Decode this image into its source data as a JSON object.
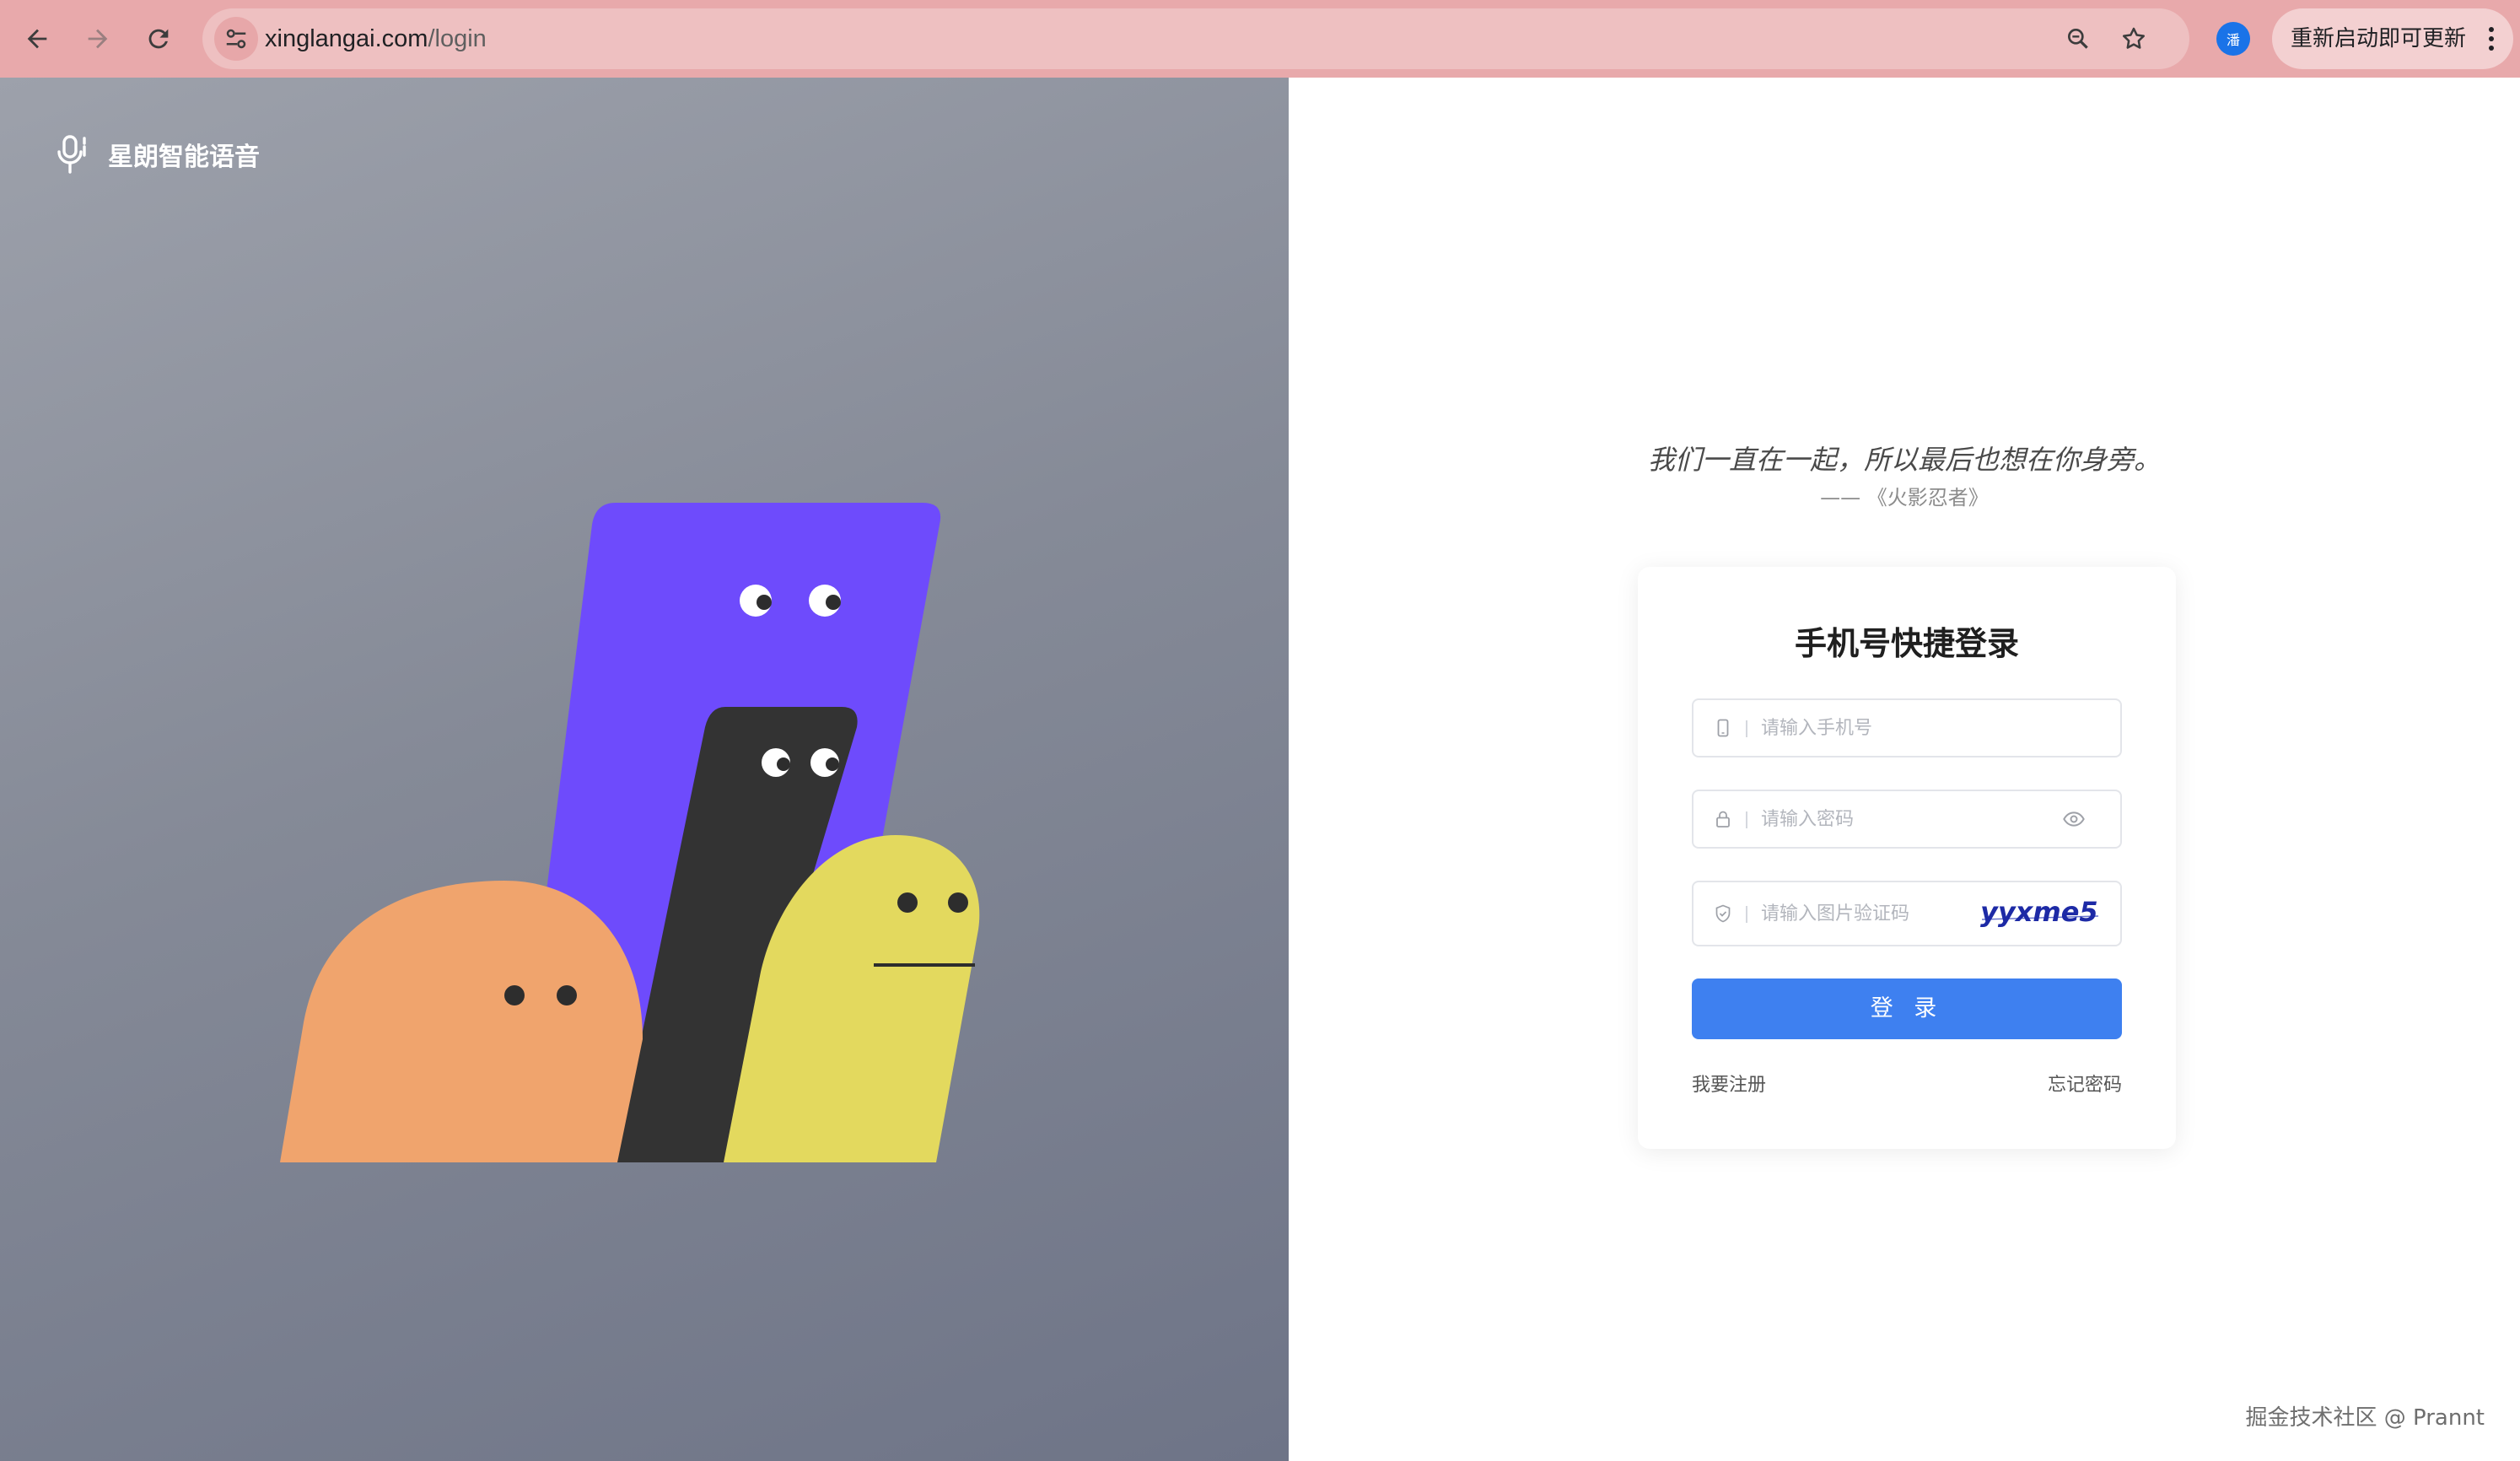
{
  "browser": {
    "url_host": "xinglangai.com",
    "url_path": "/login",
    "profile_initial": "潘",
    "update_label": "重新启动即可更新",
    "icons": [
      "back-arrow-icon",
      "forward-arrow-icon",
      "reload-icon",
      "site-info-icon",
      "zoom-icon",
      "bookmark-star-icon",
      "kebab-menu-icon"
    ]
  },
  "brand": {
    "name": "星朗智能语音",
    "icon": "microphone-icon"
  },
  "quote": {
    "text": "我们一直在一起，所以最后也想在你身旁。",
    "source": "—— 《火影忍者》"
  },
  "login": {
    "title": "手机号快捷登录",
    "phone_placeholder": "请输入手机号",
    "password_placeholder": "请输入密码",
    "captcha_placeholder": "请输入图片验证码",
    "captcha_text": "yyxme5",
    "submit_label": "登 录",
    "register_link": "我要注册",
    "forgot_link": "忘记密码"
  },
  "colors": {
    "chrome_bg": "#e8a9ab",
    "primary_button": "#3e80f0",
    "character_purple": "#6e4bfc",
    "character_black": "#333333",
    "character_orange": "#f0a46d",
    "character_yellow": "#e3d95e"
  },
  "watermark": "掘金技术社区 @ Prannt"
}
